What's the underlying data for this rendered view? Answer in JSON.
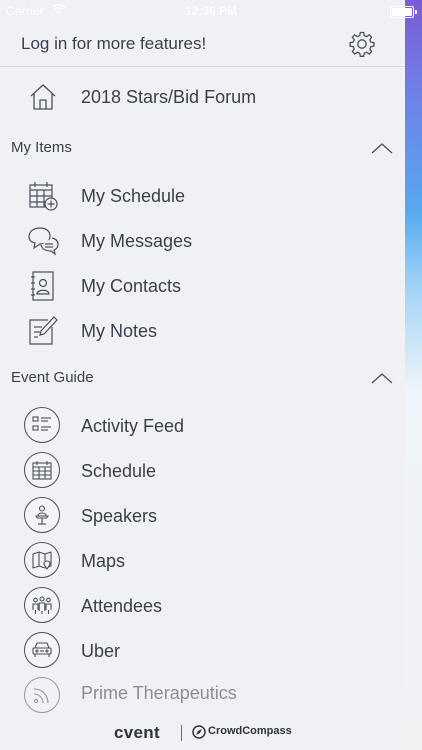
{
  "status_bar": {
    "carrier": "Carrier",
    "time": "12:36 PM"
  },
  "header": {
    "login_text": "Log in for more features!",
    "settings_icon": "gear-icon"
  },
  "home": {
    "label": "2018 Stars/Bid Forum",
    "icon": "home-icon"
  },
  "my_items": {
    "title": "My Items",
    "items": [
      {
        "label": "My Schedule",
        "icon": "calendar-plus-icon"
      },
      {
        "label": "My Messages",
        "icon": "chat-bubbles-icon"
      },
      {
        "label": "My Contacts",
        "icon": "contact-book-icon"
      },
      {
        "label": "My Notes",
        "icon": "note-pencil-icon"
      }
    ]
  },
  "event_guide": {
    "title": "Event Guide",
    "items": [
      {
        "label": "Activity Feed",
        "icon": "list-icon"
      },
      {
        "label": "Schedule",
        "icon": "calendar-grid-icon"
      },
      {
        "label": "Speakers",
        "icon": "speaker-podium-icon"
      },
      {
        "label": "Maps",
        "icon": "map-pin-icon"
      },
      {
        "label": "Attendees",
        "icon": "people-icon"
      },
      {
        "label": "Uber",
        "icon": "car-icon"
      },
      {
        "label": "Prime Therapeutics",
        "icon": "rss-icon"
      }
    ]
  },
  "footer": {
    "brand_left": "cvent",
    "brand_right": "CrowdCompass"
  }
}
